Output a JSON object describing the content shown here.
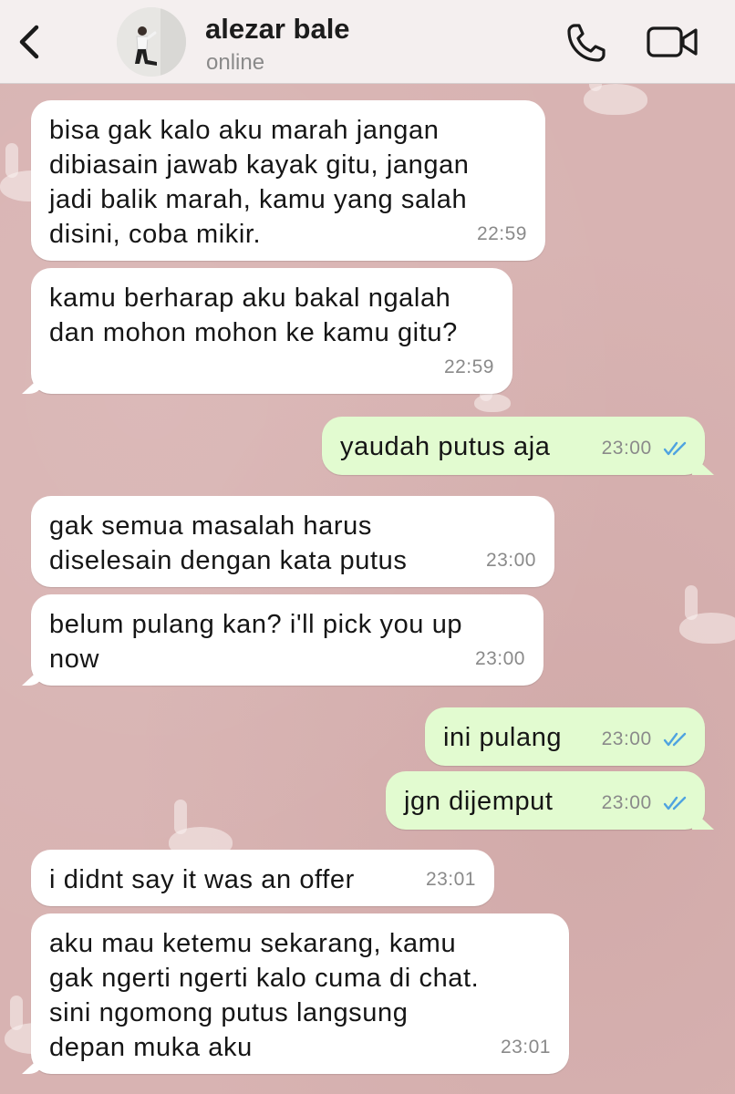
{
  "header": {
    "contact_name": "alezar bale",
    "status": "online"
  },
  "messages": [
    {
      "dir": "in",
      "text": "bisa gak kalo aku marah jangan\ndibiasain jawab kayak gitu, jangan\njadi balik marah, kamu yang salah\ndisini, coba mikir.",
      "time": "22:59"
    },
    {
      "dir": "in",
      "text": "kamu berharap aku bakal ngalah\ndan mohon mohon ke kamu gitu?",
      "time": "22:59"
    },
    {
      "dir": "out",
      "text": "yaudah putus aja",
      "time": "23:00",
      "status": "read"
    },
    {
      "dir": "in",
      "text": "gak semua masalah harus\ndiselesain dengan kata putus",
      "time": "23:00"
    },
    {
      "dir": "in",
      "text": "belum pulang kan? i'll pick you up\nnow",
      "time": "23:00"
    },
    {
      "dir": "out",
      "text": "ini pulang",
      "time": "23:00",
      "status": "read"
    },
    {
      "dir": "out",
      "text": "jgn dijemput",
      "time": "23:00",
      "status": "read"
    },
    {
      "dir": "in",
      "text": "i didnt say it was an offer",
      "time": "23:01"
    },
    {
      "dir": "in",
      "text": "aku mau ketemu sekarang, kamu\ngak ngerti ngerti kalo cuma di chat.\nsini ngomong putus langsung\ndepan muka aku",
      "time": "23:01"
    }
  ],
  "colors": {
    "incoming_bubble": "#ffffff",
    "outgoing_bubble": "#e2fbd0",
    "read_ticks": "#4fa3e0",
    "wallpaper": "#d8b3b2"
  },
  "icons": {
    "back": "chevron-left-icon",
    "call": "phone-icon",
    "video": "video-camera-icon",
    "read": "double-check-icon"
  }
}
